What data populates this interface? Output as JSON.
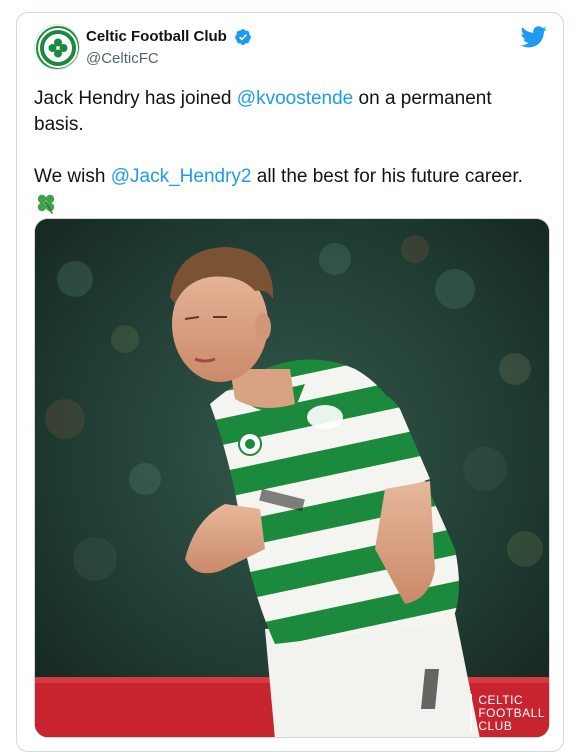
{
  "tweet": {
    "author_name": "Celtic Football Club",
    "author_handle": "@CelticFC",
    "paragraph1": {
      "before": "Jack Hendry has joined ",
      "mention": "@kvoostende",
      "after": " on a permanent basis."
    },
    "paragraph2": {
      "before": "We wish ",
      "mention": "@Jack_Hendry2",
      "after": " all the best for his future career."
    },
    "emoji": "four-leaf-clover",
    "verified": true
  },
  "media": {
    "description_icon": "player-photo",
    "watermark_lines": [
      "CELTIC",
      "FOOTBALL",
      "CLUB"
    ]
  },
  "icons": {
    "brand": "twitter-bird-icon",
    "verified": "verified-badge-icon"
  },
  "colors": {
    "link": "#1d9bf0",
    "celtic_green": "#1b8a3c",
    "verified": "#1d9bf0"
  }
}
